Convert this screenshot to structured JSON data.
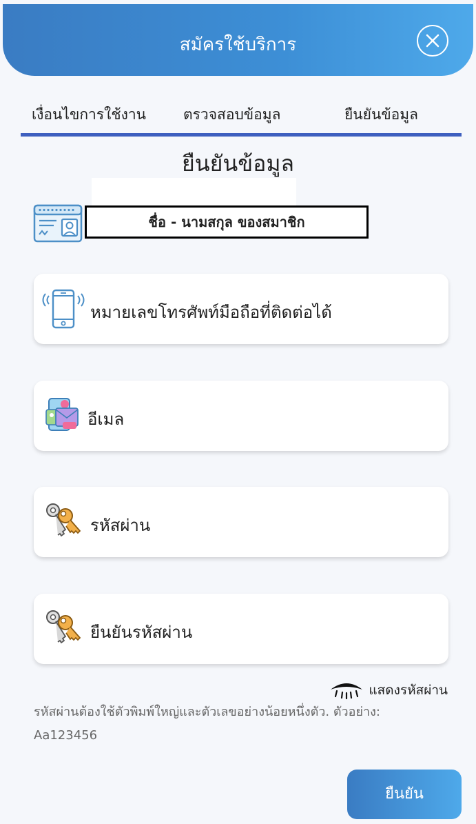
{
  "header": {
    "title": "สมัครใช้บริการ"
  },
  "tabs": [
    {
      "label": "เงื่อนไขการใช้งาน"
    },
    {
      "label": "ตรวจสอบข้อมูล"
    },
    {
      "label": "ยืนยันข้อมูล"
    }
  ],
  "section_title": "ยืนยันข้อมูล",
  "member": {
    "name_label": "ชื่อ - นามสกุล ของสมาชิก"
  },
  "fields": [
    {
      "label": "หมายเลขโทรศัพท์มือถือที่ติดต่อได้",
      "icon": "mobile-phone-icon"
    },
    {
      "label": "อีเมล",
      "icon": "email-icon"
    },
    {
      "label": "รหัสผ่าน",
      "icon": "keys-icon"
    },
    {
      "label": "ยืนยันรหัสผ่าน",
      "icon": "keys-icon"
    }
  ],
  "show_password": {
    "label": "แสดงรหัสผ่าน"
  },
  "hint": {
    "line1": "รหัสผ่านต้องใช้ตัวพิมพ์ใหญ่และตัวเลขอย่างน้อยหนึ่งตัว. ตัวอย่าง:",
    "line2": "Aa123456"
  },
  "confirm_button": {
    "label": "ยืนยัน"
  },
  "colors": {
    "header_start": "#3a7cc3",
    "header_end": "#4ea9ea",
    "tab_underline": "#3e5fbf",
    "background": "#f5f7fb"
  }
}
